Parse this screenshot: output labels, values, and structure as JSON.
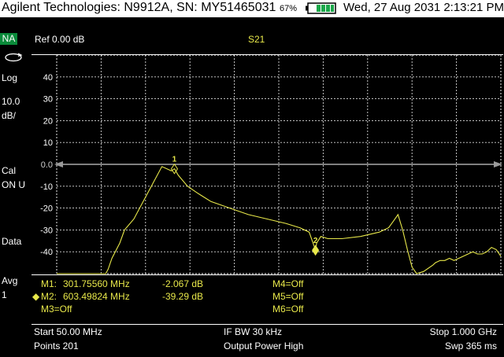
{
  "titlebar": {
    "title": "Agilent Technologies: N9912A, SN: MY51465031",
    "battery_pct": "67%",
    "datetime": "Wed, 27 Aug 2031 2:13:21 PM"
  },
  "sidebar": {
    "mode": "NA",
    "scale_label": "Log",
    "scale_value": "10.0",
    "scale_unit": "dB/",
    "cal_label": "Cal",
    "cal_value": "ON U",
    "data_label": "Data",
    "avg_label": "Avg",
    "avg_value": "1"
  },
  "trace": {
    "ref_label": "Ref 0.00 dB",
    "measurement": "S21",
    "ref_marker": "0.0"
  },
  "markers": [
    {
      "label": "M1:",
      "freq": "301.75560 MHz",
      "value": "-2.067 dB",
      "active": false
    },
    {
      "label": "M2:",
      "freq": "603.49824 MHz",
      "value": "-39.29 dB",
      "active": true
    },
    {
      "label": "M3=Off"
    },
    {
      "label": "M4=Off"
    },
    {
      "label": "M5=Off"
    },
    {
      "label": "M6=Off"
    }
  ],
  "footer": {
    "start": "Start 50.00 MHz",
    "points": "Points 201",
    "ifbw": "IF BW 30 kHz",
    "power": "Output Power High",
    "stop": "Stop 1.000 GHz",
    "sweep": "Swp 365 ms"
  },
  "colors": {
    "trace": "#e8e84a",
    "grid": "#ffffff",
    "badge": "#0a8a3a"
  },
  "chart_data": {
    "type": "line",
    "x_range_mhz": [
      50,
      1000
    ],
    "ylim": [
      -50,
      50
    ],
    "yticks": [
      40,
      30,
      20,
      10,
      0,
      -10,
      -20,
      -30,
      -40
    ],
    "ytick_labels": [
      "40",
      "30",
      "20",
      "10",
      "0.0",
      "-10",
      "-20",
      "-30",
      "-40"
    ],
    "ref_level_db": 0,
    "grid": true,
    "series": [
      {
        "x": [
          50,
          80,
          100,
          138,
          155,
          160,
          168,
          185,
          195,
          215,
          235,
          255,
          275,
          295,
          302,
          310,
          330,
          350,
          380,
          420,
          460,
          500,
          540,
          570,
          590,
          600,
          603.5,
          606,
          615,
          630,
          660,
          700,
          740,
          760,
          770,
          780,
          790,
          800,
          810,
          820,
          835,
          855,
          860,
          870,
          880,
          890,
          900,
          910,
          920,
          930,
          940,
          950,
          960,
          970,
          980,
          990,
          1000
        ],
        "y": [
          -50,
          -50,
          -50,
          -50,
          -50,
          -48,
          -43,
          -36,
          -30,
          -25,
          -17,
          -9,
          -1,
          -3,
          -2,
          -5,
          -10,
          -13,
          -17,
          -20,
          -23,
          -25,
          -27,
          -29,
          -31,
          -37,
          -39,
          -36,
          -33,
          -34,
          -34,
          -33,
          -31,
          -29,
          -26,
          -23,
          -30,
          -39,
          -47,
          -50,
          -49,
          -46,
          -45,
          -44,
          -44,
          -43,
          -44,
          -43,
          -42,
          -41,
          -40,
          -41,
          -41,
          -40,
          -38,
          -39,
          -42
        ]
      }
    ],
    "marker_points": [
      {
        "id": "1",
        "x": 301.7556,
        "y": -2.067
      },
      {
        "id": "2",
        "x": 603.49824,
        "y": -39.29
      }
    ]
  }
}
